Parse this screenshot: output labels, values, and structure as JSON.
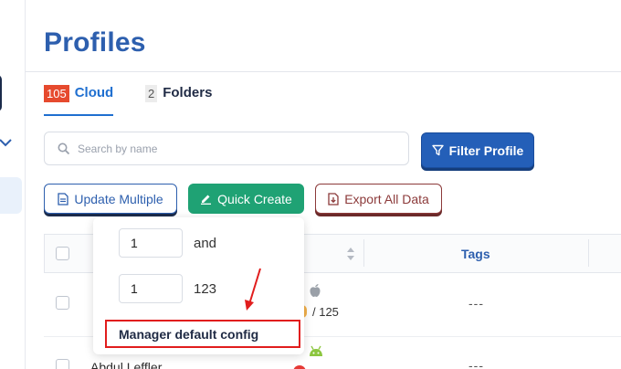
{
  "page": {
    "title": "Profiles"
  },
  "tabs": [
    {
      "count": "105",
      "label": "Cloud",
      "active": true
    },
    {
      "count": "2",
      "label": "Folders",
      "active": false
    }
  ],
  "search": {
    "placeholder": "Search by name"
  },
  "filter_button": {
    "label": "Filter Profile"
  },
  "actions": {
    "update_multiple": "Update Multiple",
    "quick_create": "Quick Create",
    "export_all": "Export All Data"
  },
  "table": {
    "columns": [
      "",
      "",
      "Tags"
    ],
    "rows": [
      {
        "name": "",
        "version_suffix": "/ 125",
        "tags": "---"
      },
      {
        "name": "Abdul Leffler",
        "tags": "---"
      }
    ]
  },
  "popup": {
    "items": [
      {
        "value": "1",
        "label": "and"
      },
      {
        "value": "1",
        "label": "123"
      }
    ],
    "manager_label": "Manager default config"
  },
  "colors": {
    "brand_blue": "#2d5fae",
    "filter_blue": "#245fb8",
    "cloud_badge": "#e64a2e",
    "quick_green": "#1fa274",
    "export_maroon": "#8c3a3a",
    "annotation_red": "#e11d1d"
  }
}
